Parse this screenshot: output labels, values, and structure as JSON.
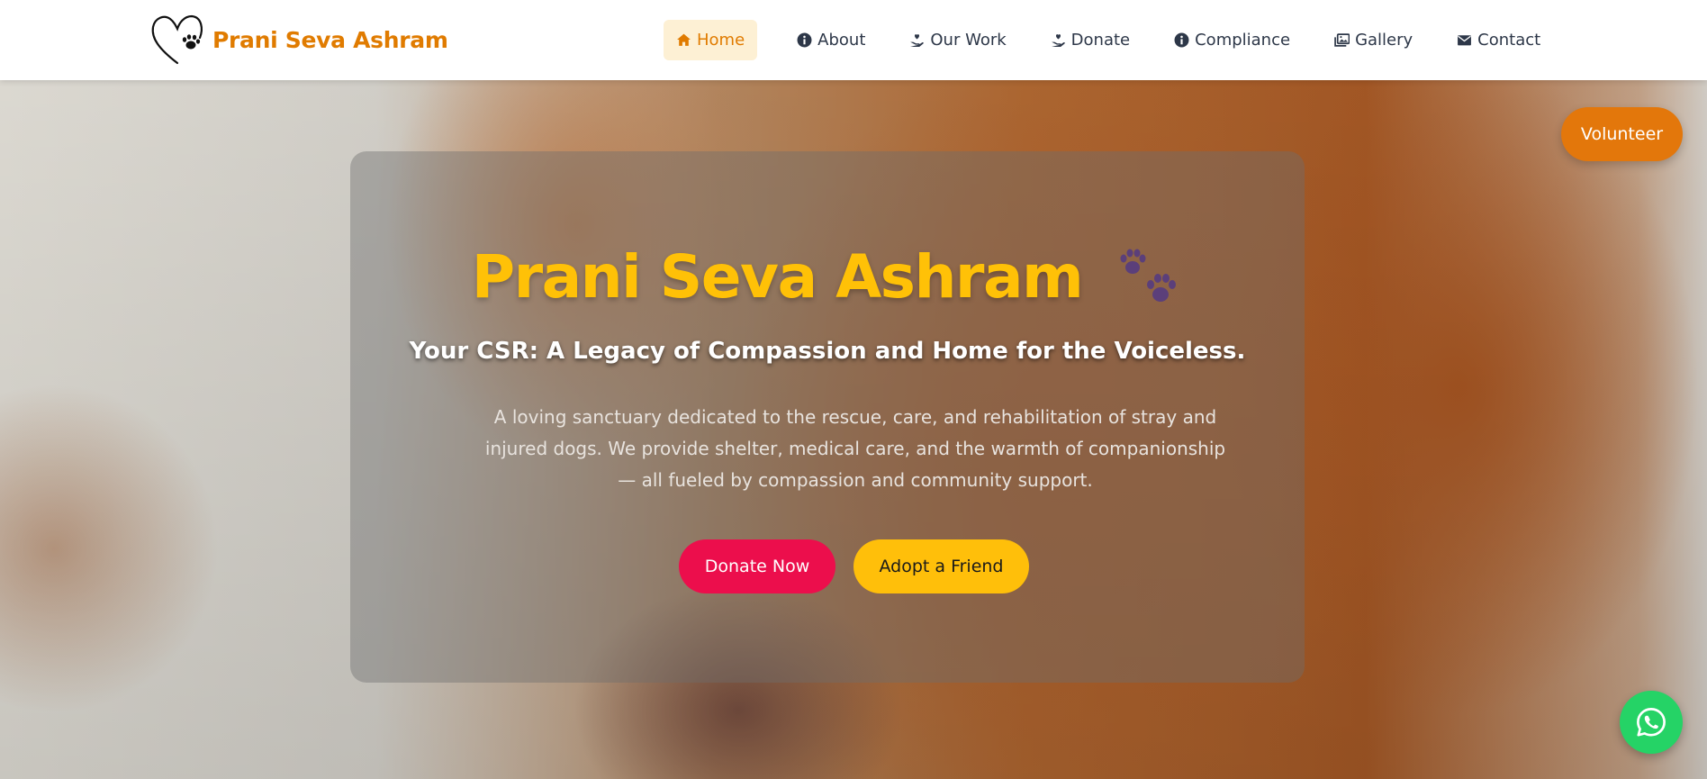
{
  "brand": {
    "name": "Prani Seva Ashram",
    "logo_icon": "heart-paw-icon",
    "color": "#e07b00"
  },
  "nav": {
    "items": [
      {
        "label": "Home",
        "icon": "home-icon",
        "active": true
      },
      {
        "label": "About",
        "icon": "info-icon",
        "active": false
      },
      {
        "label": "Our Work",
        "icon": "hand-holding-heart-icon",
        "active": false
      },
      {
        "label": "Donate",
        "icon": "hand-holding-heart-icon",
        "active": false
      },
      {
        "label": "Compliance",
        "icon": "info-icon",
        "active": false
      },
      {
        "label": "Gallery",
        "icon": "images-icon",
        "active": false
      },
      {
        "label": "Contact",
        "icon": "envelope-icon",
        "active": false
      }
    ]
  },
  "hero": {
    "title": "Prani Seva Ashram",
    "title_icon": "paws-icon",
    "subtitle": "Your CSR: A Legacy of Compassion and Home for the Voiceless.",
    "description_lines": [
      "A loving sanctuary dedicated to the rescue, care, and rehabilitation of stray and",
      "injured dogs. We provide shelter, medical care, and the warmth of companionship",
      "— all fueled by compassion and community support."
    ],
    "background": "dog-photo",
    "buttons": {
      "donate": "Donate Now",
      "adopt": "Adopt a Friend"
    }
  },
  "floating": {
    "volunteer": "Volunteer",
    "whatsapp_icon": "whatsapp-icon"
  },
  "colors": {
    "title_yellow": "#ffc107",
    "donate_red": "#ec0e4c",
    "adopt_yellow": "#ffbf0a",
    "volunteer_orange": "#e3770b",
    "whatsapp_green": "#25d366"
  }
}
